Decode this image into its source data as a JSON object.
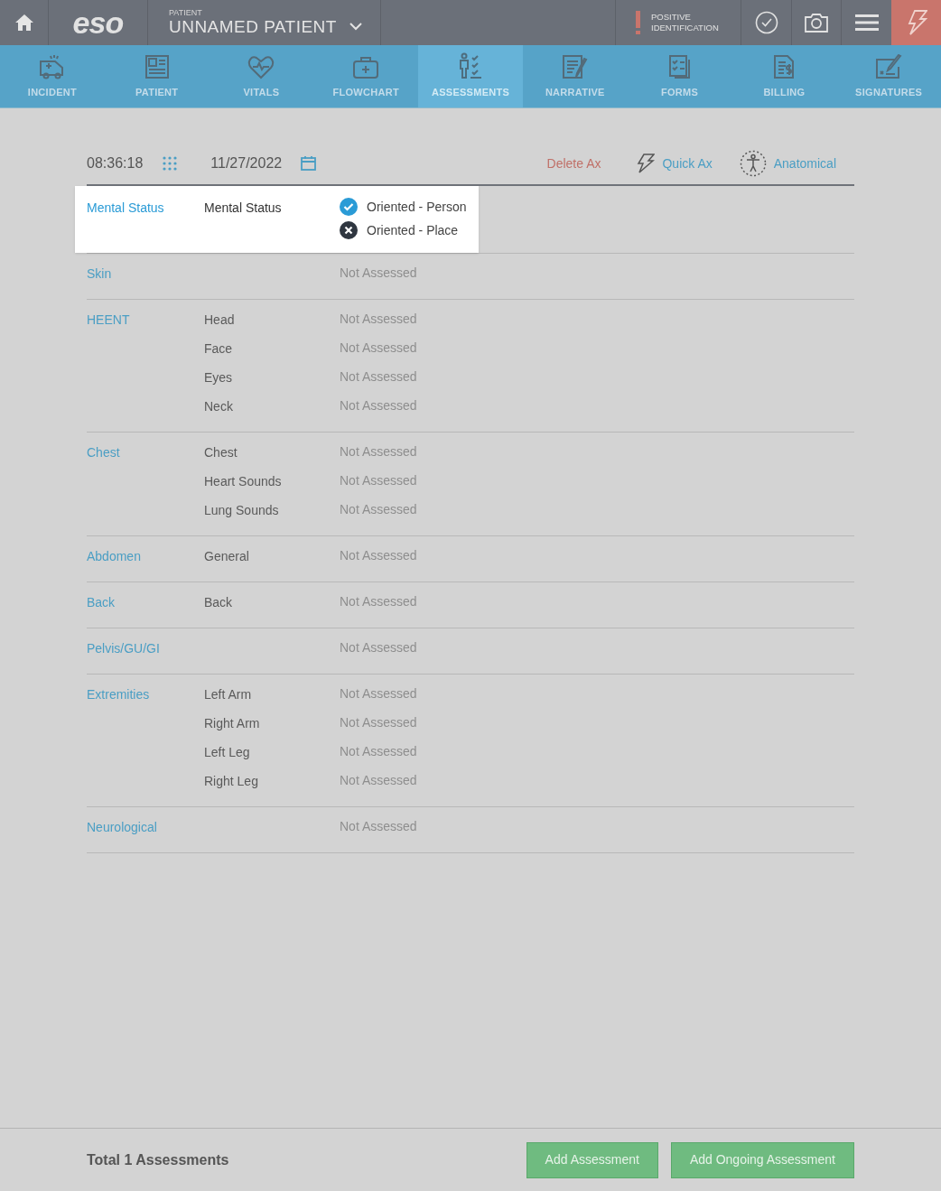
{
  "top_bar": {
    "logo": "eso",
    "patient_caption": "PATIENT",
    "patient_name": "UNNAMED PATIENT",
    "alert_lines": [
      "POSITIVE",
      "IDENTIFICATION"
    ]
  },
  "nav_tabs": [
    {
      "label": "INCIDENT",
      "selected": false
    },
    {
      "label": "PATIENT",
      "selected": false
    },
    {
      "label": "VITALS",
      "selected": false
    },
    {
      "label": "FLOWCHART",
      "selected": false
    },
    {
      "label": "ASSESSMENTS",
      "selected": true
    },
    {
      "label": "NARRATIVE",
      "selected": false
    },
    {
      "label": "FORMS",
      "selected": false
    },
    {
      "label": "BILLING",
      "selected": false
    },
    {
      "label": "SIGNATURES",
      "selected": false
    }
  ],
  "toolbar": {
    "time": "08:36:18",
    "date": "11/27/2022",
    "delete": "Delete Ax",
    "quick": "Quick Ax",
    "anatomical": "Anatomical"
  },
  "sections": [
    {
      "title": "Mental Status",
      "highlighted": true,
      "rows": [
        {
          "label": "Mental Status",
          "findings": [
            {
              "text": "Oriented - Person",
              "kind": "positive"
            },
            {
              "text": "Oriented - Place",
              "kind": "negative"
            }
          ]
        }
      ]
    },
    {
      "title": "Skin",
      "highlighted": false,
      "rows": [
        {
          "value": "Not Assessed"
        }
      ]
    },
    {
      "title": "HEENT",
      "highlighted": false,
      "rows": [
        {
          "label": "Head",
          "value": "Not Assessed"
        },
        {
          "label": "Face",
          "value": "Not Assessed"
        },
        {
          "label": "Eyes",
          "value": "Not Assessed"
        },
        {
          "label": "Neck",
          "value": "Not Assessed"
        }
      ]
    },
    {
      "title": "Chest",
      "highlighted": false,
      "rows": [
        {
          "label": "Chest",
          "value": "Not Assessed"
        },
        {
          "label": "Heart Sounds",
          "value": "Not Assessed"
        },
        {
          "label": "Lung Sounds",
          "value": "Not Assessed"
        }
      ]
    },
    {
      "title": "Abdomen",
      "highlighted": false,
      "rows": [
        {
          "label": "General",
          "value": "Not Assessed"
        }
      ]
    },
    {
      "title": "Back",
      "highlighted": false,
      "rows": [
        {
          "label": "Back",
          "value": "Not Assessed"
        }
      ]
    },
    {
      "title": "Pelvis/GU/GI",
      "highlighted": false,
      "rows": [
        {
          "value": "Not Assessed"
        }
      ]
    },
    {
      "title": "Extremities",
      "highlighted": false,
      "rows": [
        {
          "label": "Left Arm",
          "value": "Not Assessed"
        },
        {
          "label": "Right Arm",
          "value": "Not Assessed"
        },
        {
          "label": "Left Leg",
          "value": "Not Assessed"
        },
        {
          "label": "Right Leg",
          "value": "Not Assessed"
        }
      ]
    },
    {
      "title": "Neurological",
      "highlighted": false,
      "rows": [
        {
          "value": "Not Assessed"
        }
      ]
    }
  ],
  "footer": {
    "total": "Total 1 Assessments",
    "buttons": [
      "Add Assessment",
      "Add Ongoing Assessment"
    ]
  }
}
